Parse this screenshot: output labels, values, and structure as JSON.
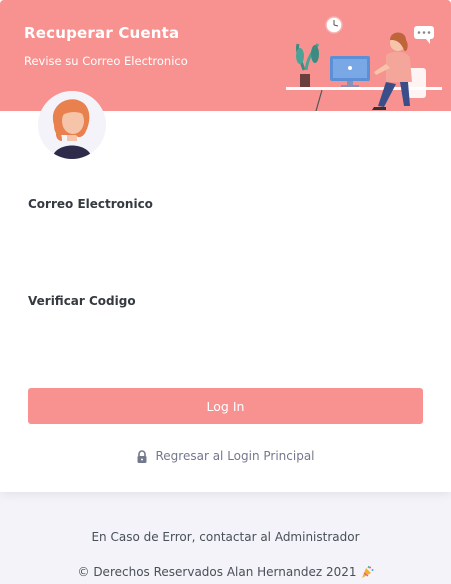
{
  "header": {
    "title": "Recuperar Cuenta",
    "subtitle": "Revise su Correo Electronico"
  },
  "form": {
    "email_label": "Correo Electronico",
    "email_value": "",
    "code_label": "Verificar Codigo",
    "code_value": "",
    "submit_label": "Log In"
  },
  "back_link": {
    "label": "Regresar al Login Principal",
    "icon": "lock-icon"
  },
  "footer": {
    "notice": "En Caso de Error, contactar al Administrador",
    "copyright": "© Derechos Reservados Alan Hernandez 2021",
    "copyright_icon": "party-popper-icon"
  },
  "colors": {
    "accent": "#f79291",
    "background": "#f3f3f9",
    "card": "#ffffff",
    "text_dark": "#343a40",
    "text_muted": "#74788d"
  }
}
